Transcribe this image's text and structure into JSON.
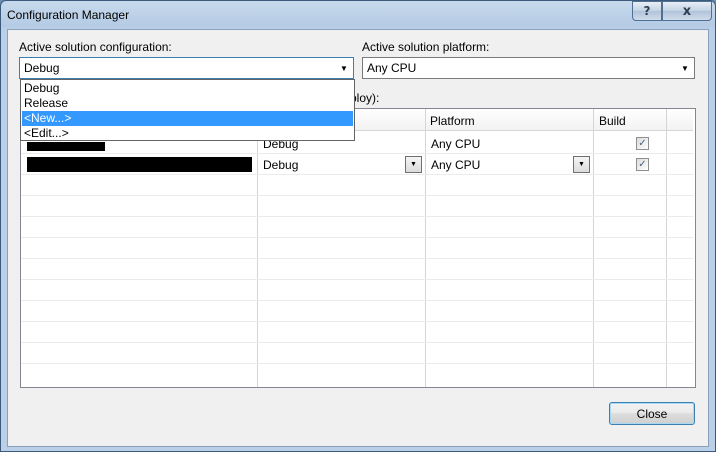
{
  "window": {
    "title": "Configuration Manager",
    "help_glyph": "?",
    "close_glyph": "x"
  },
  "solution_config": {
    "label": "Active solution configuration:",
    "value": "Debug",
    "options": [
      "Debug",
      "Release",
      "<New...>",
      "<Edit...>"
    ],
    "highlighted_option": "<New...>"
  },
  "solution_platform": {
    "label": "Active solution platform:",
    "value": "Any CPU"
  },
  "project_contexts": {
    "label_visible_fragment": "ploy):",
    "columns": [
      "Platform",
      "Build"
    ],
    "rows": [
      {
        "configuration": "Debug",
        "platform": "Any CPU",
        "build": true
      },
      {
        "configuration": "Debug",
        "platform": "Any CPU",
        "build": true
      }
    ]
  },
  "buttons": {
    "close": "Close"
  },
  "icons": {
    "dropdown_arrow": "▼",
    "check": "✓"
  }
}
